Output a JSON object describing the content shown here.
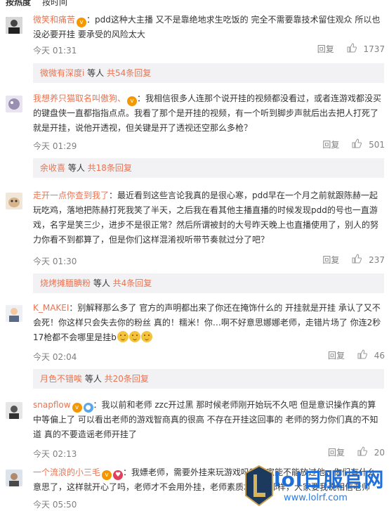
{
  "sort": {
    "hot": "按热度",
    "time": "按时间"
  },
  "comments": [
    {
      "user": "微笑和痛苦",
      "text": "：pdd这种大主播 又不是靠绝地求生吃饭的 完全不需要靠技术留住观众 所以也没必要开挂 要承受的风险太大",
      "time": "今天 01:31",
      "reply_label": "回复",
      "likes": "1737",
      "replies": {
        "name": "微微有深度i",
        "mid": " 等人 ",
        "link": "共54条回复"
      }
    },
    {
      "user": "我想养只猫取名叫傲狗、",
      "text": "：我相信很多人连那个说开挂的视频都没看过，或者连游戏都没买的键盘侠一直都指指点点。我看了那个是开挂的视频，有一个听到脚步声就后出去把人打死了就是开挂，说他开透视，但关键是开了透视还空那么多枪？",
      "time": "今天 01:29",
      "reply_label": "回复",
      "likes": "501",
      "replies": {
        "name": "余收喜",
        "mid": " 等人 ",
        "link": "共18条回复"
      }
    },
    {
      "user": "走开一点你查到我了",
      "text": "：最近看到这些言论我真的是很心寒，pdd早在一个月之前就跟陈赫一起玩吃鸡，落地把陈赫打死我笑了半天，之后我在看其他主播直播的时候发现pdd的号也一直游戏，名字是笑三少，进步不是很正常？然后所谓被封的大号昨天晚上也直播使用了，别人的努力你看不到都算了，但是你们这样混淆视听带节奏就过分了吧？",
      "time": "今天 01:30",
      "reply_label": "回复",
      "likes": "237",
      "replies": {
        "name": "烧烤摊腼腆粉",
        "mid": " 等人 ",
        "link": "共4条回复"
      }
    },
    {
      "user": "K_MAKEI",
      "text": "：别解释那么多了 官方的声明都出来了你还在掩饰什么的 开挂就是开挂 承认了又不会死！你这样只会失去你的粉丝 真的！糯米！你…啊不好意思娜娜老师，走错片场了 你连2秒17枪都不会哪里是挂b",
      "time": "今天 02:04",
      "reply_label": "回复",
      "likes": "46",
      "replies": {
        "name": "月色不错唉",
        "mid": " 等人 ",
        "link": "共20条回复"
      }
    },
    {
      "user": "snapflow",
      "text": "：我以前和老师 zzc开过黑 那时候老师刚开始玩不久吧 但是意识操作真的算中等偏上了 可以看出老师的游戏智商真的很高 不存在开挂这回事的 老师的努力你们真的不知道 真的不要造谣老师开挂了",
      "time": "今天 02:13",
      "reply_label": "回复",
      "likes": "20"
    },
    {
      "user": "一个流浪的小三毛",
      "text": "：我嫖老师，需要外挂来玩游戏吗？大家能不能放过他，你们有什么意思了，这样就开心了吗，老师才不会用外挂，老师素质才不会那样，大家要我说相信老师",
      "time": "今天 05:50",
      "reply_label": "回复",
      "likes": ""
    }
  ],
  "watermark": {
    "text": "lol日服官网",
    "url": "www.lolrf.com"
  },
  "colors": {
    "name": "#eb7350",
    "muted": "#808080",
    "reply_bg": "#f2f2f5",
    "watermark": "#1e6fd9"
  }
}
